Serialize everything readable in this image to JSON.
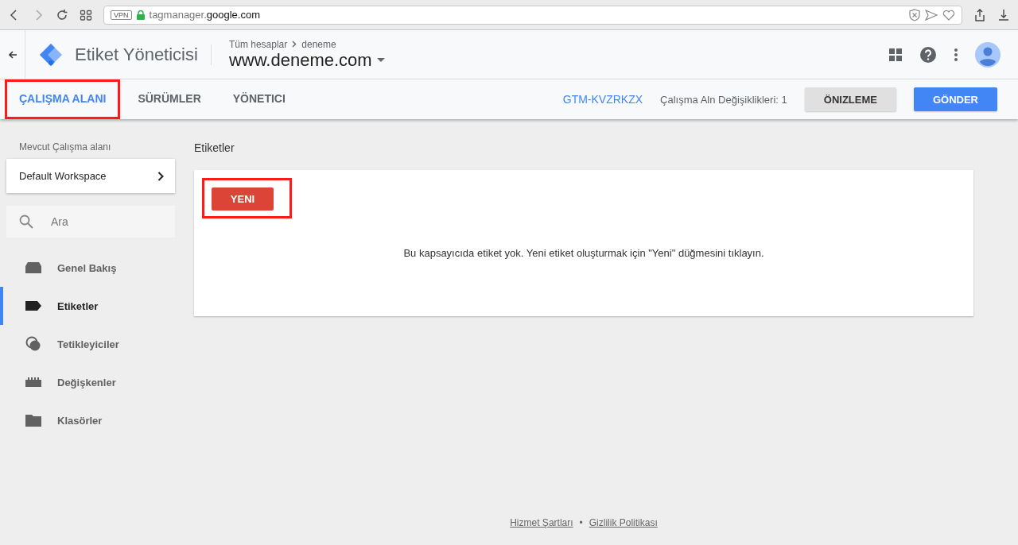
{
  "browser": {
    "vpn_badge": "VPN",
    "url_subdomain": "tagmanager.",
    "url_domain": "google.com"
  },
  "header": {
    "product": "Etiket Yöneticisi",
    "breadcrumb": "Tüm hesaplar",
    "breadcrumb_current": "deneme",
    "container": "www.deneme.com"
  },
  "tabs": [
    {
      "label": "ÇALIŞMA ALANI",
      "selected": true,
      "highlighted": true
    },
    {
      "label": "SÜRÜMLER",
      "selected": false,
      "highlighted": false
    },
    {
      "label": "YÖNETICI",
      "selected": false,
      "highlighted": false
    }
  ],
  "toolbar": {
    "container_id": "GTM-KVZRKZX",
    "changes": "Çalışma Aln Değişiklikleri: 1",
    "preview_button": "ÖNIZLEME",
    "submit_button": "GÖNDER"
  },
  "sidebar": {
    "workspace_label": "Mevcut Çalışma alanı",
    "workspace": "Default Workspace",
    "search": {
      "placeholder": "Ara"
    },
    "items": [
      {
        "kind": "overview",
        "label": "Genel Bakış",
        "selected": false
      },
      {
        "kind": "tags",
        "label": "Etiketler",
        "selected": true
      },
      {
        "kind": "triggers",
        "label": "Tetikleyiciler",
        "selected": false
      },
      {
        "kind": "variables",
        "label": "Değişkenler",
        "selected": false
      },
      {
        "kind": "folders",
        "label": "Klasörler",
        "selected": false
      }
    ]
  },
  "content": {
    "title": "Etiketler",
    "new_button": {
      "label": "YENI",
      "highlighted": true
    },
    "empty_message": "Bu kapsayıcıda etiket yok. Yeni etiket oluşturmak için \"Yeni\" düğmesini tıklayın."
  },
  "footer": {
    "links": [
      "Hizmet Şartları",
      "Gizlilik Politikası"
    ],
    "separator": "•"
  }
}
